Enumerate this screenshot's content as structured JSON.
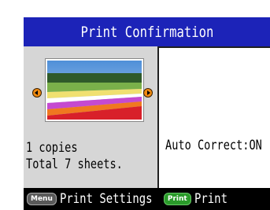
{
  "title": "Print Confirmation",
  "navigation": {
    "prev_icon": "arrow-left-icon",
    "next_icon": "arrow-right-icon"
  },
  "panel": {
    "auto_correct": "Auto Correct:ON"
  },
  "info": {
    "copies": "1 copies",
    "total": "Total 7 sheets."
  },
  "footer": {
    "menu_badge": "Menu",
    "menu_label": "Print Settings",
    "print_badge": "Print",
    "print_label": "Print"
  },
  "colors": {
    "title_bar": "#1c23b8",
    "screen_bg": "#d6d6d6",
    "arrow": "#f08a10",
    "print_badge": "#2a9a2a"
  }
}
